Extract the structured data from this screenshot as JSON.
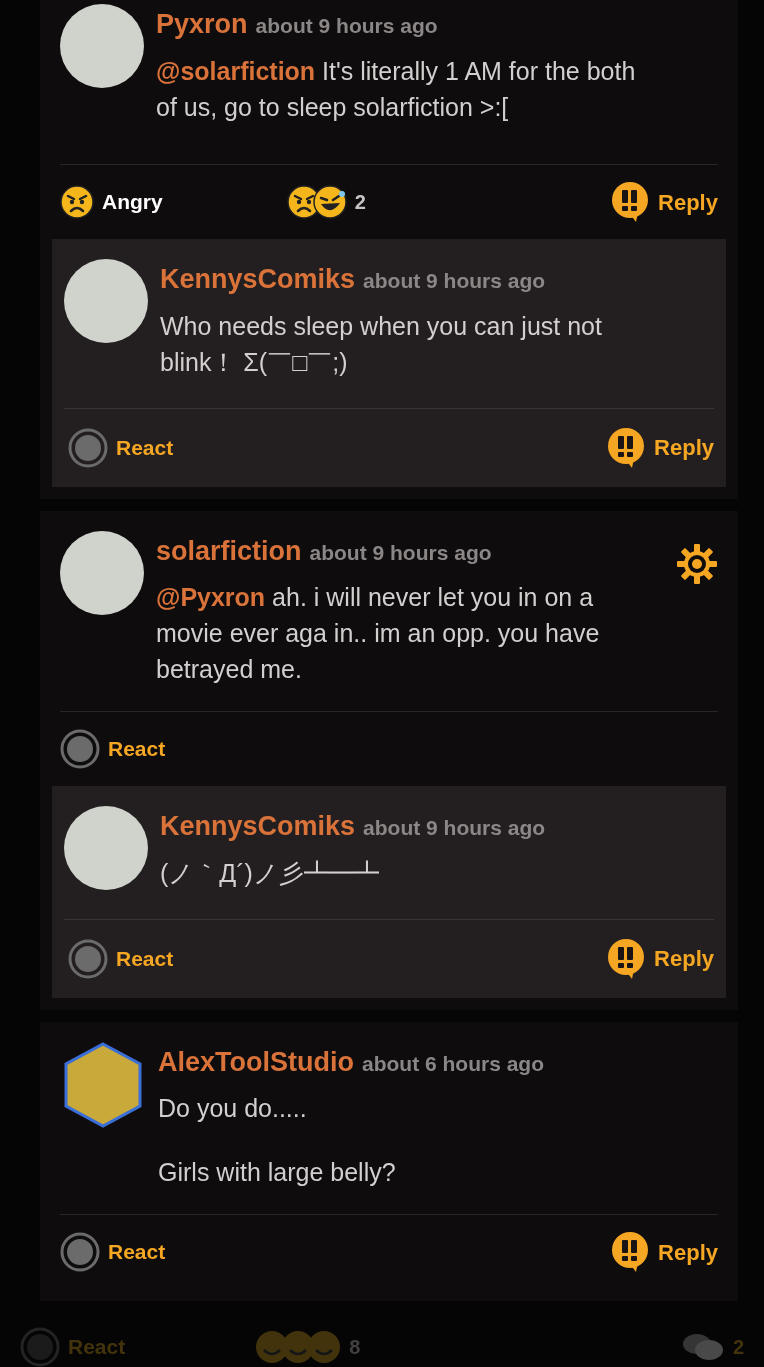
{
  "comments": [
    {
      "author": "Pyxron",
      "time": "about 9 hours ago",
      "avatar": {
        "kind": "circle"
      },
      "mention": "@solarfiction",
      "paragraphs": [
        "It's literally 1 AM for the both of us, go to sleep solarfiction >:["
      ],
      "settings": false,
      "my_reaction": {
        "kind": "angry",
        "label": "Angry"
      },
      "reaction_summary": {
        "emojis": [
          {
            "kind": "angry"
          },
          {
            "kind": "laugh"
          }
        ],
        "count": "2"
      },
      "reply_label": "Reply",
      "replies": [
        {
          "author": "KennysComiks",
          "time": "about 9 hours ago",
          "avatar": {
            "kind": "circle"
          },
          "paragraphs": [
            "Who needs sleep when you can just not blink！ Σ(￣□￣;)"
          ],
          "my_reaction": {
            "kind": "none",
            "label": "React"
          },
          "reply_label": "Reply"
        }
      ]
    },
    {
      "author": "solarfiction",
      "time": "about 9 hours ago",
      "avatar": {
        "kind": "circle"
      },
      "mention": "@Pyxron",
      "paragraphs": [
        "ah. i will never let you in on a movie ever aga in.. im an opp. you have betrayed me."
      ],
      "settings": true,
      "my_reaction": {
        "kind": "none",
        "label": "React"
      },
      "replies": [
        {
          "author": "KennysComiks",
          "time": "about 9 hours ago",
          "avatar": {
            "kind": "circle"
          },
          "paragraphs": [
            "(ノ｀Д´)ノ彡┻━┻"
          ],
          "my_reaction": {
            "kind": "none",
            "label": "React"
          },
          "reply_label": "Reply"
        }
      ]
    },
    {
      "author": "AlexToolStudio",
      "time": "about 6 hours ago",
      "avatar": {
        "kind": "hexagon"
      },
      "paragraphs": [
        "Do you do.....",
        "Girls with large belly?"
      ],
      "settings": false,
      "my_reaction": {
        "kind": "none",
        "label": "React"
      },
      "reply_label": "Reply"
    }
  ],
  "background_bar": {
    "react_label": "React",
    "reaction_count": "8",
    "comment_count": "2"
  }
}
